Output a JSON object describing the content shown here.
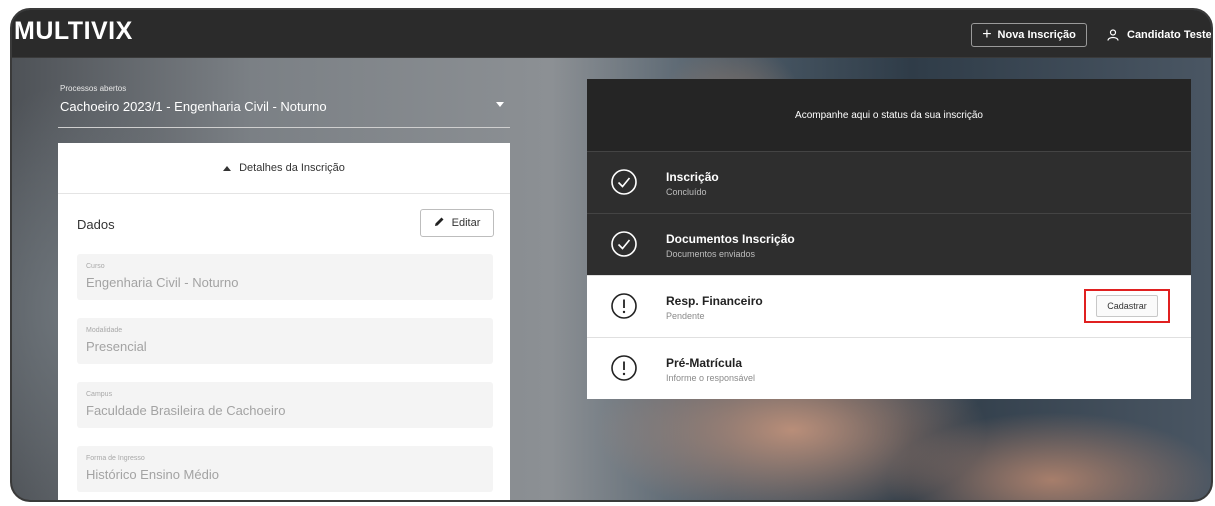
{
  "app": {
    "brand": "MULTIVIX"
  },
  "header": {
    "new_registration": "Nova Inscrição",
    "user_name": "Candidato Teste"
  },
  "process_select": {
    "label": "Processos abertos",
    "value": "Cachoeiro 2023/1 - Engenharia Civil - Noturno"
  },
  "details": {
    "toggle_label": "Detalhes da Inscrição",
    "section_title": "Dados",
    "edit_label": "Editar",
    "fields": [
      {
        "label": "Curso",
        "value": "Engenharia Civil - Noturno"
      },
      {
        "label": "Modalidade",
        "value": "Presencial"
      },
      {
        "label": "Campus",
        "value": "Faculdade Brasileira de Cachoeiro"
      },
      {
        "label": "Forma de Ingresso",
        "value": "Histórico Ensino Médio"
      }
    ]
  },
  "status": {
    "header": "Acompanhe aqui o status da sua inscrição",
    "steps": [
      {
        "title": "Inscrição",
        "subtitle": "Concluído",
        "icon": "check-circle-icon"
      },
      {
        "title": "Documentos Inscrição",
        "subtitle": "Documentos enviados",
        "icon": "check-circle-icon"
      },
      {
        "title": "Resp. Financeiro",
        "subtitle": "Pendente",
        "icon": "alert-circle-icon",
        "action": "Cadastrar"
      },
      {
        "title": "Pré-Matrícula",
        "subtitle": "Informe o responsável",
        "icon": "alert-circle-icon"
      }
    ]
  },
  "colors": {
    "topbar": "#2b2b2b",
    "highlight": "#e02020"
  }
}
